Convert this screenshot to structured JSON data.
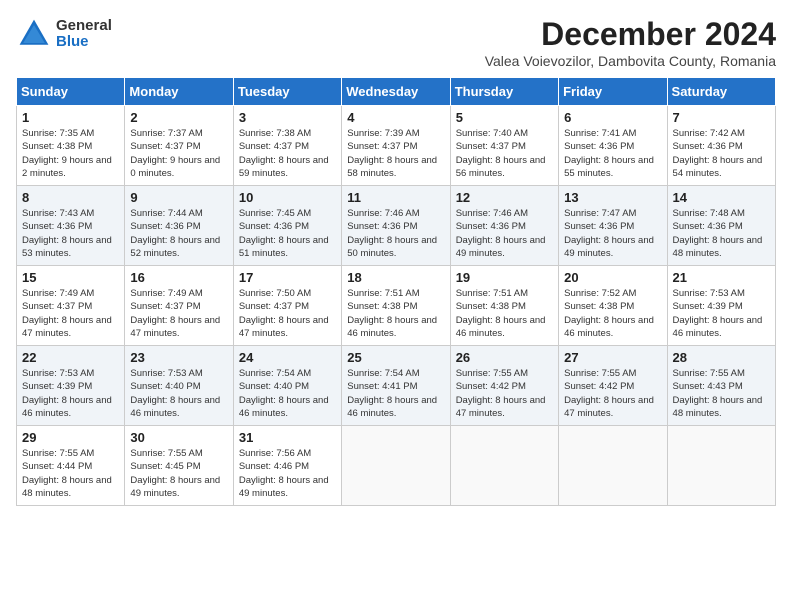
{
  "logo": {
    "general": "General",
    "blue": "Blue"
  },
  "title": "December 2024",
  "subtitle": "Valea Voievozilor, Dambovita County, Romania",
  "days_of_week": [
    "Sunday",
    "Monday",
    "Tuesday",
    "Wednesday",
    "Thursday",
    "Friday",
    "Saturday"
  ],
  "weeks": [
    [
      {
        "day": "1",
        "sunrise": "7:35 AM",
        "sunset": "4:38 PM",
        "daylight": "9 hours and 2 minutes."
      },
      {
        "day": "2",
        "sunrise": "7:37 AM",
        "sunset": "4:37 PM",
        "daylight": "9 hours and 0 minutes."
      },
      {
        "day": "3",
        "sunrise": "7:38 AM",
        "sunset": "4:37 PM",
        "daylight": "8 hours and 59 minutes."
      },
      {
        "day": "4",
        "sunrise": "7:39 AM",
        "sunset": "4:37 PM",
        "daylight": "8 hours and 58 minutes."
      },
      {
        "day": "5",
        "sunrise": "7:40 AM",
        "sunset": "4:37 PM",
        "daylight": "8 hours and 56 minutes."
      },
      {
        "day": "6",
        "sunrise": "7:41 AM",
        "sunset": "4:36 PM",
        "daylight": "8 hours and 55 minutes."
      },
      {
        "day": "7",
        "sunrise": "7:42 AM",
        "sunset": "4:36 PM",
        "daylight": "8 hours and 54 minutes."
      }
    ],
    [
      {
        "day": "8",
        "sunrise": "7:43 AM",
        "sunset": "4:36 PM",
        "daylight": "8 hours and 53 minutes."
      },
      {
        "day": "9",
        "sunrise": "7:44 AM",
        "sunset": "4:36 PM",
        "daylight": "8 hours and 52 minutes."
      },
      {
        "day": "10",
        "sunrise": "7:45 AM",
        "sunset": "4:36 PM",
        "daylight": "8 hours and 51 minutes."
      },
      {
        "day": "11",
        "sunrise": "7:46 AM",
        "sunset": "4:36 PM",
        "daylight": "8 hours and 50 minutes."
      },
      {
        "day": "12",
        "sunrise": "7:46 AM",
        "sunset": "4:36 PM",
        "daylight": "8 hours and 49 minutes."
      },
      {
        "day": "13",
        "sunrise": "7:47 AM",
        "sunset": "4:36 PM",
        "daylight": "8 hours and 49 minutes."
      },
      {
        "day": "14",
        "sunrise": "7:48 AM",
        "sunset": "4:36 PM",
        "daylight": "8 hours and 48 minutes."
      }
    ],
    [
      {
        "day": "15",
        "sunrise": "7:49 AM",
        "sunset": "4:37 PM",
        "daylight": "8 hours and 47 minutes."
      },
      {
        "day": "16",
        "sunrise": "7:49 AM",
        "sunset": "4:37 PM",
        "daylight": "8 hours and 47 minutes."
      },
      {
        "day": "17",
        "sunrise": "7:50 AM",
        "sunset": "4:37 PM",
        "daylight": "8 hours and 47 minutes."
      },
      {
        "day": "18",
        "sunrise": "7:51 AM",
        "sunset": "4:38 PM",
        "daylight": "8 hours and 46 minutes."
      },
      {
        "day": "19",
        "sunrise": "7:51 AM",
        "sunset": "4:38 PM",
        "daylight": "8 hours and 46 minutes."
      },
      {
        "day": "20",
        "sunrise": "7:52 AM",
        "sunset": "4:38 PM",
        "daylight": "8 hours and 46 minutes."
      },
      {
        "day": "21",
        "sunrise": "7:53 AM",
        "sunset": "4:39 PM",
        "daylight": "8 hours and 46 minutes."
      }
    ],
    [
      {
        "day": "22",
        "sunrise": "7:53 AM",
        "sunset": "4:39 PM",
        "daylight": "8 hours and 46 minutes."
      },
      {
        "day": "23",
        "sunrise": "7:53 AM",
        "sunset": "4:40 PM",
        "daylight": "8 hours and 46 minutes."
      },
      {
        "day": "24",
        "sunrise": "7:54 AM",
        "sunset": "4:40 PM",
        "daylight": "8 hours and 46 minutes."
      },
      {
        "day": "25",
        "sunrise": "7:54 AM",
        "sunset": "4:41 PM",
        "daylight": "8 hours and 46 minutes."
      },
      {
        "day": "26",
        "sunrise": "7:55 AM",
        "sunset": "4:42 PM",
        "daylight": "8 hours and 47 minutes."
      },
      {
        "day": "27",
        "sunrise": "7:55 AM",
        "sunset": "4:42 PM",
        "daylight": "8 hours and 47 minutes."
      },
      {
        "day": "28",
        "sunrise": "7:55 AM",
        "sunset": "4:43 PM",
        "daylight": "8 hours and 48 minutes."
      }
    ],
    [
      {
        "day": "29",
        "sunrise": "7:55 AM",
        "sunset": "4:44 PM",
        "daylight": "8 hours and 48 minutes."
      },
      {
        "day": "30",
        "sunrise": "7:55 AM",
        "sunset": "4:45 PM",
        "daylight": "8 hours and 49 minutes."
      },
      {
        "day": "31",
        "sunrise": "7:56 AM",
        "sunset": "4:46 PM",
        "daylight": "8 hours and 49 minutes."
      },
      null,
      null,
      null,
      null
    ]
  ]
}
